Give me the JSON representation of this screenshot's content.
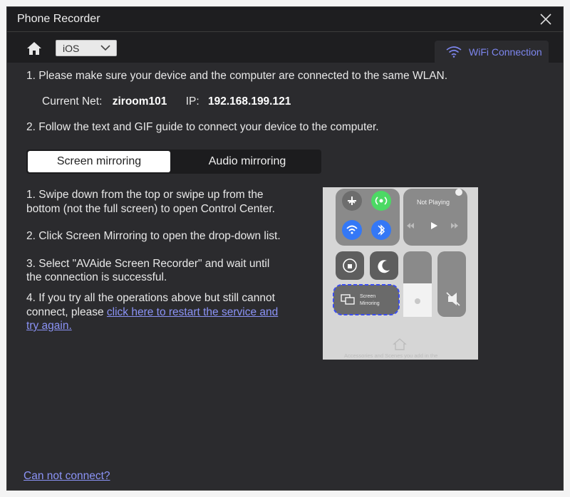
{
  "window": {
    "title": "Phone Recorder"
  },
  "toolbar": {
    "os_value": "iOS",
    "wifi_tab_label": "WiFi Connection"
  },
  "content": {
    "step1": "1. Please make sure your device and the computer are connected to the same WLAN.",
    "current_net_label": "Current Net:",
    "current_net_value": "ziroom101",
    "ip_label": "IP:",
    "ip_value": "192.168.199.121",
    "step2": "2. Follow the text and GIF guide to connect your device to the computer.",
    "tabs": [
      {
        "label": "Screen mirroring",
        "active": true
      },
      {
        "label": "Audio mirroring",
        "active": false
      }
    ],
    "instructions": {
      "s1_line1": "1. Swipe down from the top or swipe up from the",
      "s1_line2": "bottom (not the full screen) to open Control Center.",
      "s2": "2. Click Screen Mirroring to open the drop-down list.",
      "s3_line1": "3. Select \"AVAide Screen Recorder\" and wait until",
      "s3_line2": "the connection is successful.",
      "s4_line1": "4. If you try all the operations above but still cannot",
      "s4_line2_prefix": "connect, please ",
      "s4_link_part1": "click here to restart the service and",
      "s4_link_part2": "try again."
    },
    "cant_connect_link": "Can not connect?"
  },
  "phone_image": {
    "not_playing": "Not Playing",
    "screen_mirroring_line1": "Screen",
    "screen_mirroring_line2": "Mirroring",
    "footer_text": "Accessories and Scenes you add in the"
  },
  "colors": {
    "accent": "#7d86ee",
    "link": "#8b93f6",
    "panel_bg": "#2b2b2e",
    "window_bg": "#1e1e20"
  }
}
